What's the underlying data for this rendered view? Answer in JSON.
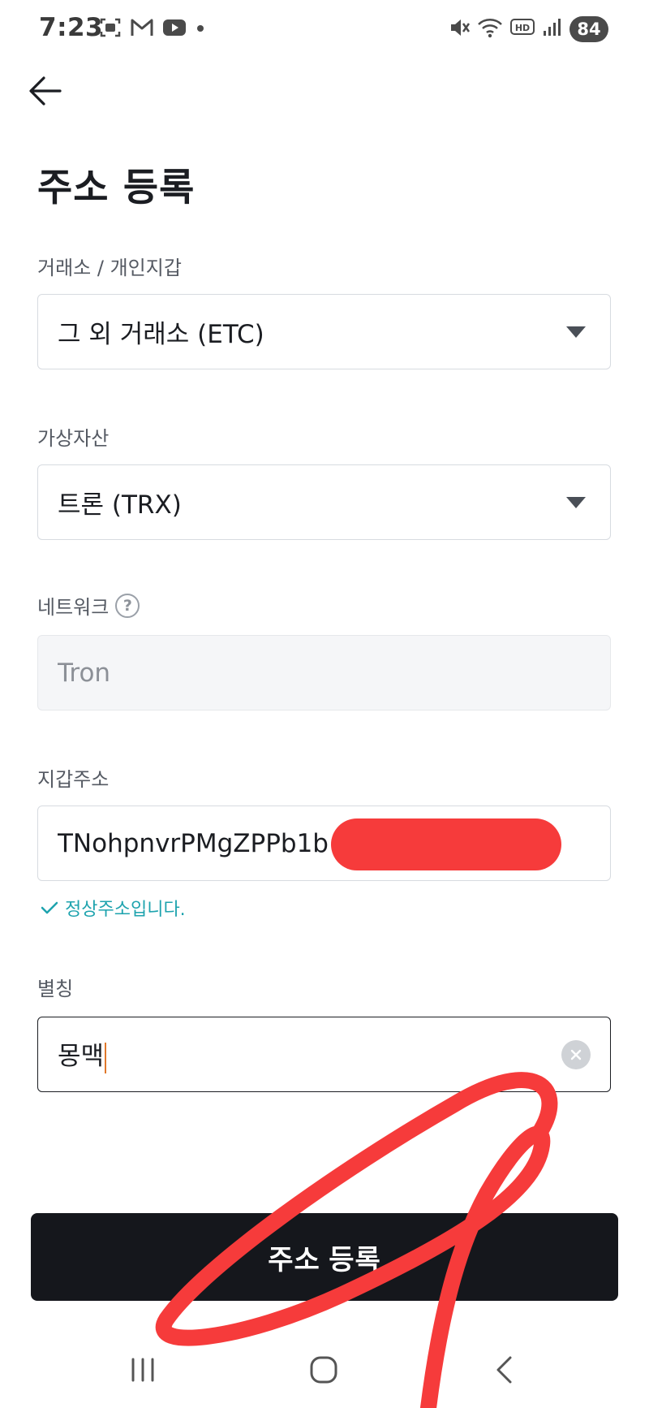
{
  "status_bar": {
    "time": "7:23",
    "left_icons": [
      "screenshot-icon",
      "gmail-icon",
      "youtube-icon",
      "dot-icon"
    ],
    "right_icons": [
      "mute-icon",
      "wifi-icon",
      "hd-icon",
      "signal-icon"
    ],
    "battery": "84"
  },
  "header": {
    "title": "주소 등록"
  },
  "form": {
    "exchange": {
      "label": "거래소 / 개인지갑",
      "value": "그 외 거래소 (ETC)"
    },
    "asset": {
      "label": "가상자산",
      "value": "트론 (TRX)"
    },
    "network": {
      "label": "네트워크",
      "help": "?",
      "value": "Tron"
    },
    "wallet": {
      "label": "지갑주소",
      "value": "TNohpnvrPMgZPPb1b",
      "valid_message": "정상주소입니다."
    },
    "alias": {
      "label": "별칭",
      "value": "몽맥"
    }
  },
  "submit_label": "주소 등록",
  "colors": {
    "primary": "#15171c",
    "valid": "#1ea3ae",
    "annotation": "#f63b3b"
  }
}
